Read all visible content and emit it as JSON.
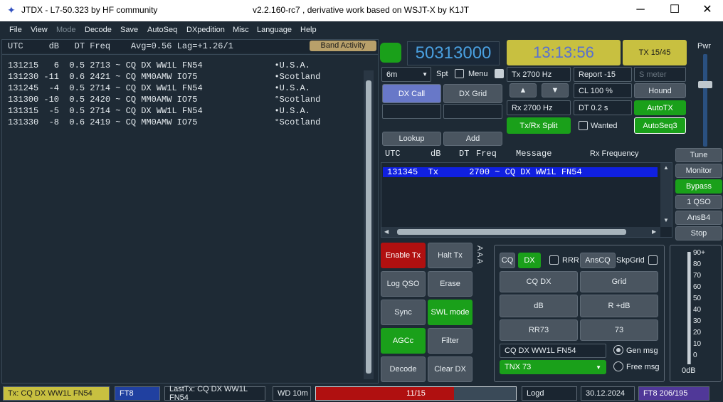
{
  "titlebar": {
    "app": "JTDX - L7-50.323  by HF community",
    "version": "v2.2.160-rc7 , derivative work based on WSJT-X by K1JT",
    "min": "─",
    "max": "☐",
    "close": "✕"
  },
  "menu": [
    "File",
    "View",
    "Mode",
    "Decode",
    "Save",
    "AutoSeq",
    "DXpedition",
    "Misc",
    "Language",
    "Help"
  ],
  "left": {
    "header": "UTC     dB   DT Freq    Avg=0.56 Lag=+1.26/1",
    "band_activity": "Band Activity",
    "rows": [
      "131215   6  0.5 2713 ~ CQ DX WW1L FN54              •U.S.A.",
      "131230 -11  0.6 2421 ~ CQ MM0AMW IO75               •Scotland",
      "131245  -4  0.5 2714 ~ CQ DX WW1L FN54              •U.S.A.",
      "131300 -10  0.5 2420 ~ CQ MM0AMW IO75               °Scotland",
      "131315  -5  0.5 2714 ~ CQ DX WW1L FN54              •U.S.A.",
      "131330  -8  0.6 2419 ~ CQ MM0AMW IO75               °Scotland"
    ]
  },
  "top": {
    "frequency": "50313000",
    "clock": "13:13:56",
    "tx_period": "TX 15/45",
    "band": "6m",
    "spt": "Spt",
    "menu": "Menu",
    "tx_hz": "Tx  2700  Hz",
    "rx_hz": "Rx  2700  Hz",
    "report": "Report -15",
    "smeter": "S meter",
    "cl": "CL  100 %",
    "dt": "DT 0.2 s",
    "hound": "Hound",
    "autotx": "AutoTX",
    "autoseq3": "AutoSeq3",
    "wanted": "Wanted",
    "split": "Tx/Rx Split",
    "dxcall": "DX Call",
    "dxgrid": "DX Grid",
    "lookup": "Lookup",
    "add": "Add",
    "up": "▲",
    "down": "▼",
    "pwr": "Pwr"
  },
  "rx": {
    "header_utc": "UTC",
    "header_db": "dB",
    "header_dt": "DT",
    "header_freq": "Freq",
    "header_msg": "Message",
    "header_rxf": "Rx Frequency",
    "row": "131345  Tx      2700 ~ CQ DX WW1L FN54"
  },
  "right_buttons": [
    "Tune",
    "Monitor",
    "Bypass",
    "1 QSO",
    "AnsB4",
    "Stop"
  ],
  "controls": {
    "enable_tx": "Enable Tx",
    "halt_tx": "Halt Tx",
    "log_qso": "Log QSO",
    "erase": "Erase",
    "sync": "Sync",
    "swl": "SWL mode",
    "agcc": "AGCc",
    "filter": "Filter",
    "decode": "Decode",
    "clear_dx": "Clear DX",
    "arrows": "A A A"
  },
  "gen": {
    "cq": "CQ",
    "dx": "DX",
    "rrr": "RRR",
    "anscq": "AnsCQ",
    "skpgrid": "SkpGrid",
    "cqdx": "CQ DX",
    "grid": "Grid",
    "db": "dB",
    "rdb": "R +dB",
    "rr73": "RR73",
    "s73": "73",
    "msg_field": "CQ DX WW1L FN54",
    "tnx": "TNX 73",
    "gen_msg": "Gen msg",
    "free_msg": "Free msg"
  },
  "meter": {
    "labels": [
      "90+",
      "80",
      "70",
      "60",
      "50",
      "40",
      "30",
      "20",
      "10",
      "0"
    ],
    "unit": "0dB"
  },
  "status": {
    "tx": "Tx: CQ DX WW1L FN54",
    "mode": "FT8",
    "lasttx": "LastTx: CQ DX WW1L FN54",
    "wd": "WD 10m",
    "progress": "11/15",
    "progress_fraction": 0.69,
    "logd": "Logd",
    "date": "30.12.2024",
    "ft8count": "FT8  206/195"
  },
  "colors": {
    "accent_green": "#1aa01a",
    "clock_bg": "#c8c040",
    "tx_red": "#b01010",
    "freq_blue": "#4aa0e0"
  }
}
